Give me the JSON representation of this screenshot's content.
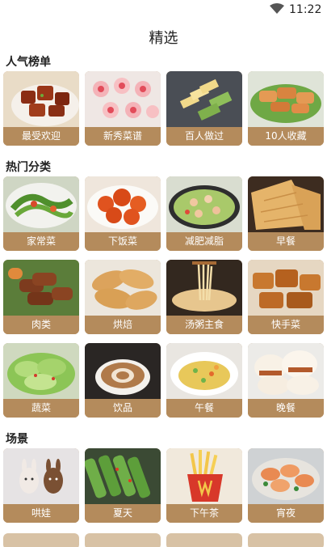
{
  "status_bar": {
    "time": "11:22"
  },
  "header": {
    "title": "精选"
  },
  "sections": {
    "trending": {
      "title": "人气榜单",
      "items": [
        {
          "label": "最受欢迎",
          "icon": "braised-pork-photo"
        },
        {
          "label": "新秀菜谱",
          "icon": "flower-dumplings-photo"
        },
        {
          "label": "百人做过",
          "icon": "layered-cake-photo"
        },
        {
          "label": "10人收藏",
          "icon": "fried-chicken-photo"
        }
      ]
    },
    "categories": {
      "title": "热门分类",
      "items": [
        {
          "label": "家常菜",
          "icon": "home-dish-photo"
        },
        {
          "label": "下饭菜",
          "icon": "sweet-sour-pork-photo"
        },
        {
          "label": "减肥减脂",
          "icon": "salad-photo"
        },
        {
          "label": "早餐",
          "icon": "pancake-photo"
        },
        {
          "label": "肉类",
          "icon": "meat-photo"
        },
        {
          "label": "烘焙",
          "icon": "croissant-photo"
        },
        {
          "label": "汤粥主食",
          "icon": "noodles-photo"
        },
        {
          "label": "快手菜",
          "icon": "quick-dish-photo"
        },
        {
          "label": "蔬菜",
          "icon": "cabbage-photo"
        },
        {
          "label": "饮品",
          "icon": "latte-photo"
        },
        {
          "label": "午餐",
          "icon": "rice-plate-photo"
        },
        {
          "label": "晚餐",
          "icon": "buns-photo"
        }
      ]
    },
    "scenes": {
      "title": "场景",
      "items": [
        {
          "label": "哄娃",
          "icon": "bunny-popsicle-photo"
        },
        {
          "label": "夏天",
          "icon": "cucumber-photo"
        },
        {
          "label": "下午茶",
          "icon": "fries-photo"
        },
        {
          "label": "宵夜",
          "icon": "seafood-photo"
        }
      ]
    }
  },
  "colors": {
    "card_label_bg": "#b48b5c",
    "card_label_text": "#ffffff"
  }
}
